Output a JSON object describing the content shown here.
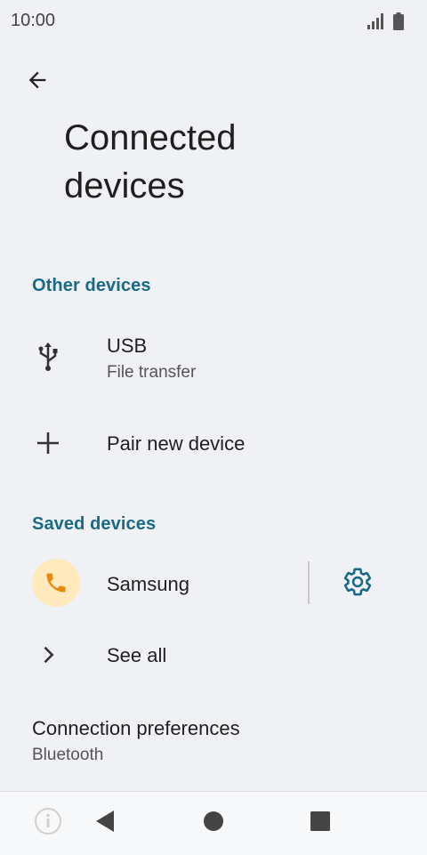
{
  "status_bar": {
    "time": "10:00",
    "icons": [
      "signal-icon",
      "battery-icon"
    ]
  },
  "header": {
    "back_icon": "arrow-back-icon",
    "title": "Connected\ndevices"
  },
  "other_devices": {
    "section_label": "Other devices",
    "usb": {
      "icon": "usb-icon",
      "title": "USB",
      "subtitle": "File transfer"
    },
    "pair": {
      "icon": "plus-icon",
      "title": "Pair new device"
    }
  },
  "saved_devices": {
    "section_label": "Saved devices",
    "device": {
      "icon": "phone-icon",
      "name": "Samsung",
      "settings_icon": "gear-icon"
    },
    "see_all": {
      "icon": "chevron-right-icon",
      "label": "See all"
    }
  },
  "connection_preferences": {
    "title": "Connection preferences",
    "subtitle": "Bluetooth"
  },
  "nav_bar": {
    "icons": [
      "info-icon",
      "back-triangle-icon",
      "home-circle-icon",
      "recents-square-icon"
    ]
  },
  "colors": {
    "background": "#eff1f5",
    "accent": "#196a85",
    "avatar_bg": "#ffe9bd",
    "phone_icon": "#e8890c"
  }
}
